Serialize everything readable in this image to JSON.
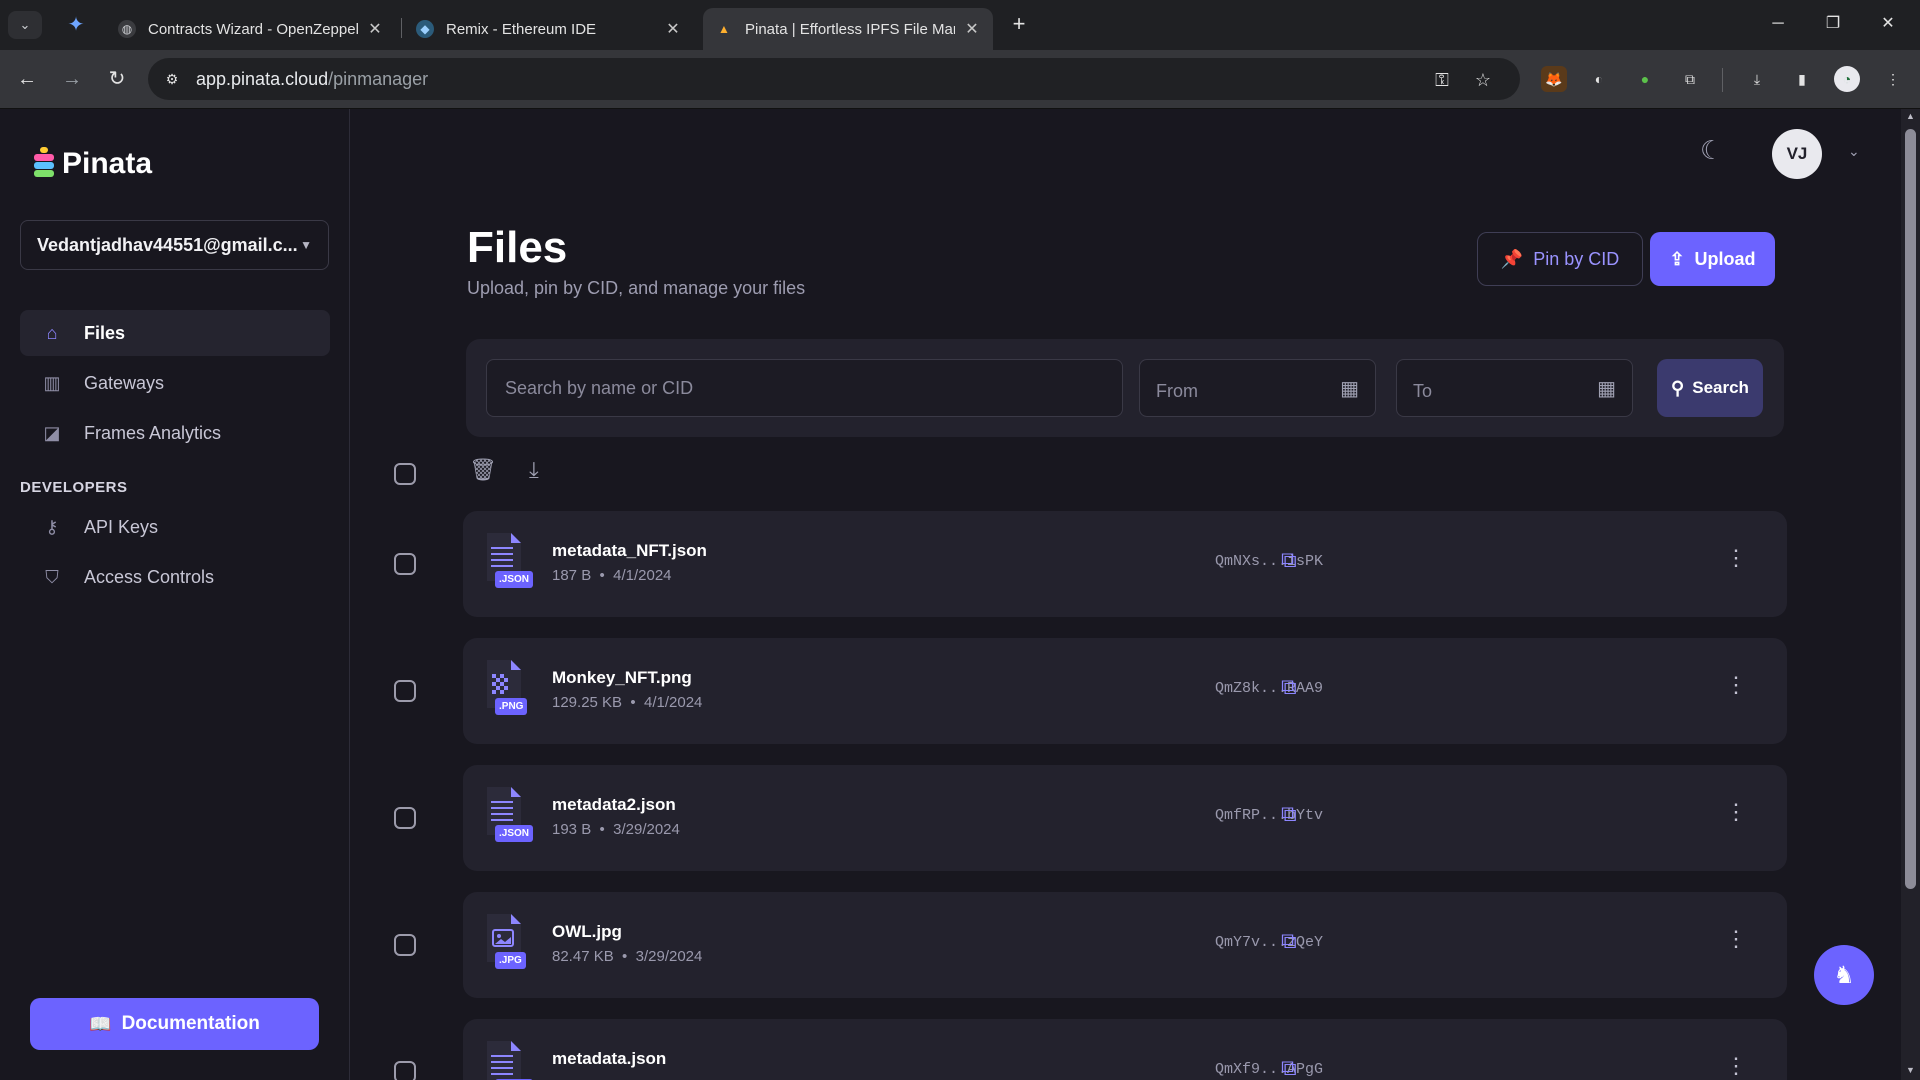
{
  "browser": {
    "tabs": [
      {
        "title": "Contracts Wizard - OpenZeppelin",
        "active": false
      },
      {
        "title": "Remix - Ethereum IDE",
        "active": false
      },
      {
        "title": "Pinata | Effortless IPFS File Management",
        "active": true
      }
    ],
    "url_host": "app.pinata.cloud",
    "url_path": "/pinmanager"
  },
  "sidebar": {
    "logo": "Pinata",
    "account": "Vedantjadhav44551@gmail.c...",
    "nav": [
      {
        "label": "Files",
        "icon": "home-icon"
      },
      {
        "label": "Gateways",
        "icon": "chart-icon"
      },
      {
        "label": "Frames Analytics",
        "icon": "analytics-icon"
      }
    ],
    "developers_label": "DEVELOPERS",
    "dev_nav": [
      {
        "label": "API Keys",
        "icon": "key-icon"
      },
      {
        "label": "Access Controls",
        "icon": "shield-icon"
      }
    ],
    "documentation": "Documentation"
  },
  "header": {
    "avatar": "VJ",
    "title": "Files",
    "subtitle": "Upload, pin by CID, and manage your files",
    "pin_by_cid": "Pin by CID",
    "upload": "Upload"
  },
  "filters": {
    "search_placeholder": "Search by name or CID",
    "from": "From",
    "to": "To",
    "search_button": "Search"
  },
  "files": [
    {
      "name": "metadata_NFT.json",
      "size": "187 B",
      "date": "4/1/2024",
      "cid": "QmNXs...isPK",
      "type": ".JSON"
    },
    {
      "name": "Monkey_NFT.png",
      "size": "129.25 KB",
      "date": "4/1/2024",
      "cid": "QmZ8k...RAA9",
      "type": ".PNG"
    },
    {
      "name": "metadata2.json",
      "size": "193 B",
      "date": "3/29/2024",
      "cid": "QmfRP...bYtv",
      "type": ".JSON"
    },
    {
      "name": "OWL.jpg",
      "size": "82.47 KB",
      "date": "3/29/2024",
      "cid": "QmY7v...zQeY",
      "type": ".JPG"
    },
    {
      "name": "metadata.json",
      "size": "",
      "date": "",
      "cid": "QmXf9...APgG",
      "type": ".JSON"
    }
  ],
  "colors": {
    "accent": "#6c63ff",
    "background": "#18171f",
    "card": "#23222d"
  }
}
